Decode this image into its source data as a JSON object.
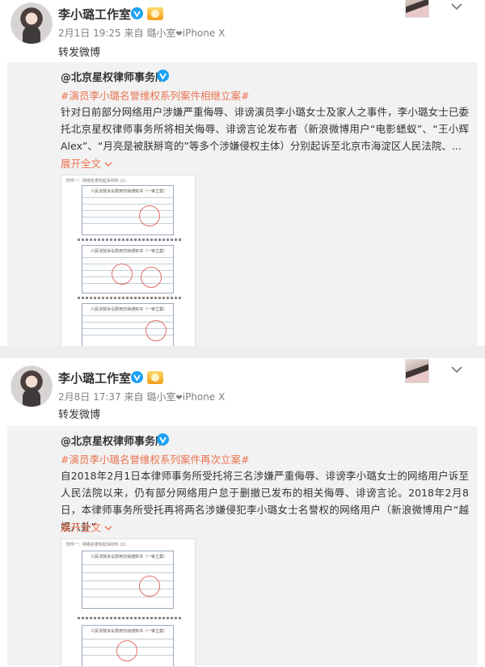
{
  "colors": {
    "accent": "#eb7350",
    "verified": "#1da1f2",
    "meta": "#808080",
    "panel": "#f2f2f2"
  },
  "posts": [
    {
      "author": "李小璐工作室",
      "date": "2月1日 19:25",
      "source_prefix": "来自",
      "source": "璐小室",
      "device": "iPhone X",
      "repost_text": "转发微博",
      "original": {
        "author": "@北京星权律师事务所",
        "hashtag": "#演员李小璐名誉维权系列案件相继立案#",
        "body": "针对日前部分网络用户涉嫌严重侮辱、诽谤演员李小璐女士及家人之事件，李小璐女士已委托北京星权律师事务所将相关侮辱、诽谤言论发布者（新浪微博用户“电影蟋蚁”、“王小辉Alex”、“月亮是被朕掰弯的”等多个涉嫌侵权主体）分别起诉至北京市海淀区人民法院、...",
        "expand_label": "展开全文",
        "doc_header": "附件一：网络名誉权起诉材料 (1)",
        "form_title": "人民法院诉讼费用交纳通知书（一审立案）"
      }
    },
    {
      "author": "李小璐工作室",
      "date": "2月8日 17:37",
      "source_prefix": "来自",
      "source": "璐小室",
      "device": "iPhone X",
      "repost_text": "转发微博",
      "original": {
        "author": "@北京星权律师事务所",
        "hashtag": "#演员李小璐名誉维权系列案件再次立案#",
        "body": "自2018年2月1日本律师事务所受托将三名涉嫌严重侮辱、诽谤李小璐女士的网络用户诉至人民法院以来，仍有部分网络用户怠于删撤已发布的相关侮辱、诽谤言论。2018年2月8日，本律师事务所受托再将两名涉嫌侵犯李小璐女士名誉权的网络用户（新浪微博用户“越娱八卦”",
        "expand_label": "展开全文",
        "doc_header": "附件一：网络名誉权起诉材料 (2)",
        "form_title": "人民法院诉讼费用交纳通知书（一审立案）"
      }
    }
  ]
}
